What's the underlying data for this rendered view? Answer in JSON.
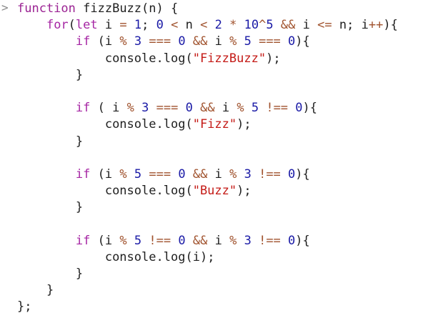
{
  "console": {
    "prompt_glyph": ">",
    "code_lines": [
      "function fizzBuzz(n) {",
      "    for(let i = 1; 0 < n < 2 * 10^5 && i <= n; i++){",
      "        if (i % 3 === 0 && i % 5 === 0){",
      "            console.log(\"FizzBuzz\");",
      "        }",
      "",
      "        if ( i % 3 === 0 && i % 5 !== 0){",
      "            console.log(\"Fizz\");",
      "        }",
      "",
      "        if (i % 5 === 0 && i % 3 !== 0){",
      "            console.log(\"Buzz\");",
      "        }",
      "",
      "        if (i % 5 !== 0 && i % 3 !== 0){",
      "            console.log(i);",
      "        }",
      "    }",
      "};"
    ]
  }
}
